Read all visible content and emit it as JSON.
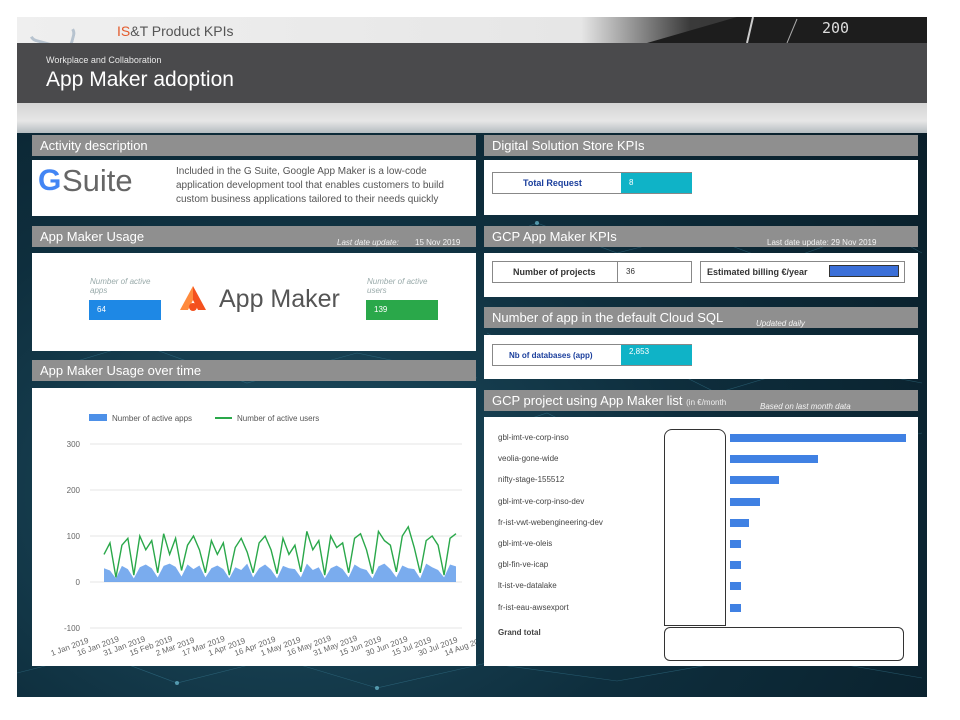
{
  "header": {
    "brand_prefix": "IS",
    "brand_amp": "&",
    "brand_rest": "T Product KPIs",
    "gauge_text": "200",
    "subtitle": "Workplace and Collaboration",
    "title": "App Maker adoption"
  },
  "activity": {
    "title": "Activity description",
    "logo_g": "G",
    "logo_word": "Suite",
    "description": "Included in the G Suite, Google App Maker is a low-code application development tool that enables customers to build custom business applications tailored to their needs quickly"
  },
  "usage": {
    "title": "App Maker Usage",
    "last_update_label": "Last date update:",
    "last_update_value": "15 Nov 2019",
    "active_apps_label": "Number of active apps",
    "active_apps_value": "64",
    "active_users_label": "Number of active users",
    "active_users_value": "139",
    "logo_text": "App Maker"
  },
  "usage_time": {
    "title": "App Maker Usage over time"
  },
  "store": {
    "title": "Digital Solution Store KPIs",
    "total_request_label": "Total Request",
    "total_request_value": "8"
  },
  "gcp": {
    "title": "GCP App Maker KPIs",
    "last_update": "Last date update: 29 Nov 2019",
    "projects_label": "Number of projects",
    "projects_value": "36",
    "billing_label": "Estimated billing €/year"
  },
  "cloudsql": {
    "title": "Number of app in the default Cloud SQL",
    "note": "Updated daily",
    "db_label": "Nb of databases (app)",
    "db_value": "2,853"
  },
  "projlist": {
    "title": "GCP project using App Maker list",
    "title_small": "(in €/month",
    "note": "Based on last month data",
    "grand_total": "Grand total",
    "projects": [
      {
        "name": "gbl-imt-ve-corp-inso",
        "share": 1.0
      },
      {
        "name": "veolia-gone-wide",
        "share": 0.5
      },
      {
        "name": "nifty-stage-155512",
        "share": 0.28
      },
      {
        "name": "gbl-imt-ve-corp-inso-dev",
        "share": 0.17
      },
      {
        "name": "fr-ist-vwt-webengineering-dev",
        "share": 0.11
      },
      {
        "name": "gbl-imt-ve-oleis",
        "share": 0.06
      },
      {
        "name": "gbl-fin-ve-icap",
        "share": 0.06
      },
      {
        "name": "lt-ist-ve-datalake",
        "share": 0.06
      },
      {
        "name": "fr-ist-eau-awsexport",
        "share": 0.06
      }
    ]
  },
  "chart_data": {
    "type": "line",
    "title": "",
    "xlabel": "",
    "ylabel": "",
    "ylim": [
      -100,
      300
    ],
    "y_ticks": [
      300,
      200,
      100,
      0,
      -100
    ],
    "x_ticks": [
      "1 Jan 2019",
      "16 Jan 2019",
      "31 Jan 2019",
      "15 Feb 2019",
      "2 Mar 2019",
      "17 Mar 2019",
      "1 Apr 2019",
      "16 Apr 2019",
      "1 May 2019",
      "16 May 2019",
      "31 May 2019",
      "15 Jun 2019",
      "30 Jun 2019",
      "15 Jul 2019",
      "30 Jul 2019",
      "14 Aug 2019"
    ],
    "legend": "top",
    "grid": true,
    "series": [
      {
        "name": "Number of active apps",
        "kind": "area",
        "color": "#4d90e8",
        "values": [
          30,
          25,
          8,
          35,
          28,
          8,
          32,
          38,
          30,
          10,
          35,
          40,
          33,
          12,
          38,
          28,
          36,
          10,
          30,
          36,
          28,
          8,
          32,
          26,
          40,
          10,
          30,
          38,
          27,
          8,
          35,
          30,
          28,
          10,
          40,
          26,
          32,
          8,
          30,
          36,
          28,
          10,
          38,
          30,
          26,
          8,
          34,
          40,
          28,
          10,
          36,
          30,
          28,
          8,
          40,
          32,
          26,
          10,
          38,
          34
        ]
      },
      {
        "name": "Number of active users",
        "kind": "line",
        "color": "#2aa84a",
        "values": [
          60,
          85,
          10,
          80,
          95,
          15,
          100,
          70,
          90,
          20,
          105,
          60,
          95,
          25,
          80,
          100,
          70,
          20,
          90,
          60,
          85,
          15,
          75,
          95,
          65,
          20,
          85,
          100,
          70,
          18,
          95,
          60,
          80,
          22,
          110,
          70,
          90,
          15,
          100,
          75,
          85,
          20,
          95,
          105,
          70,
          18,
          110,
          90,
          80,
          22,
          100,
          120,
          75,
          20,
          90,
          100,
          80,
          15,
          95,
          105
        ]
      }
    ]
  },
  "colors": {
    "accent_blue": "#1e88e5",
    "accent_green": "#2aa84a",
    "accent_teal": "#0fb3c7",
    "section_gray": "#8f8f8f",
    "header_band": "#4a4a4c"
  }
}
